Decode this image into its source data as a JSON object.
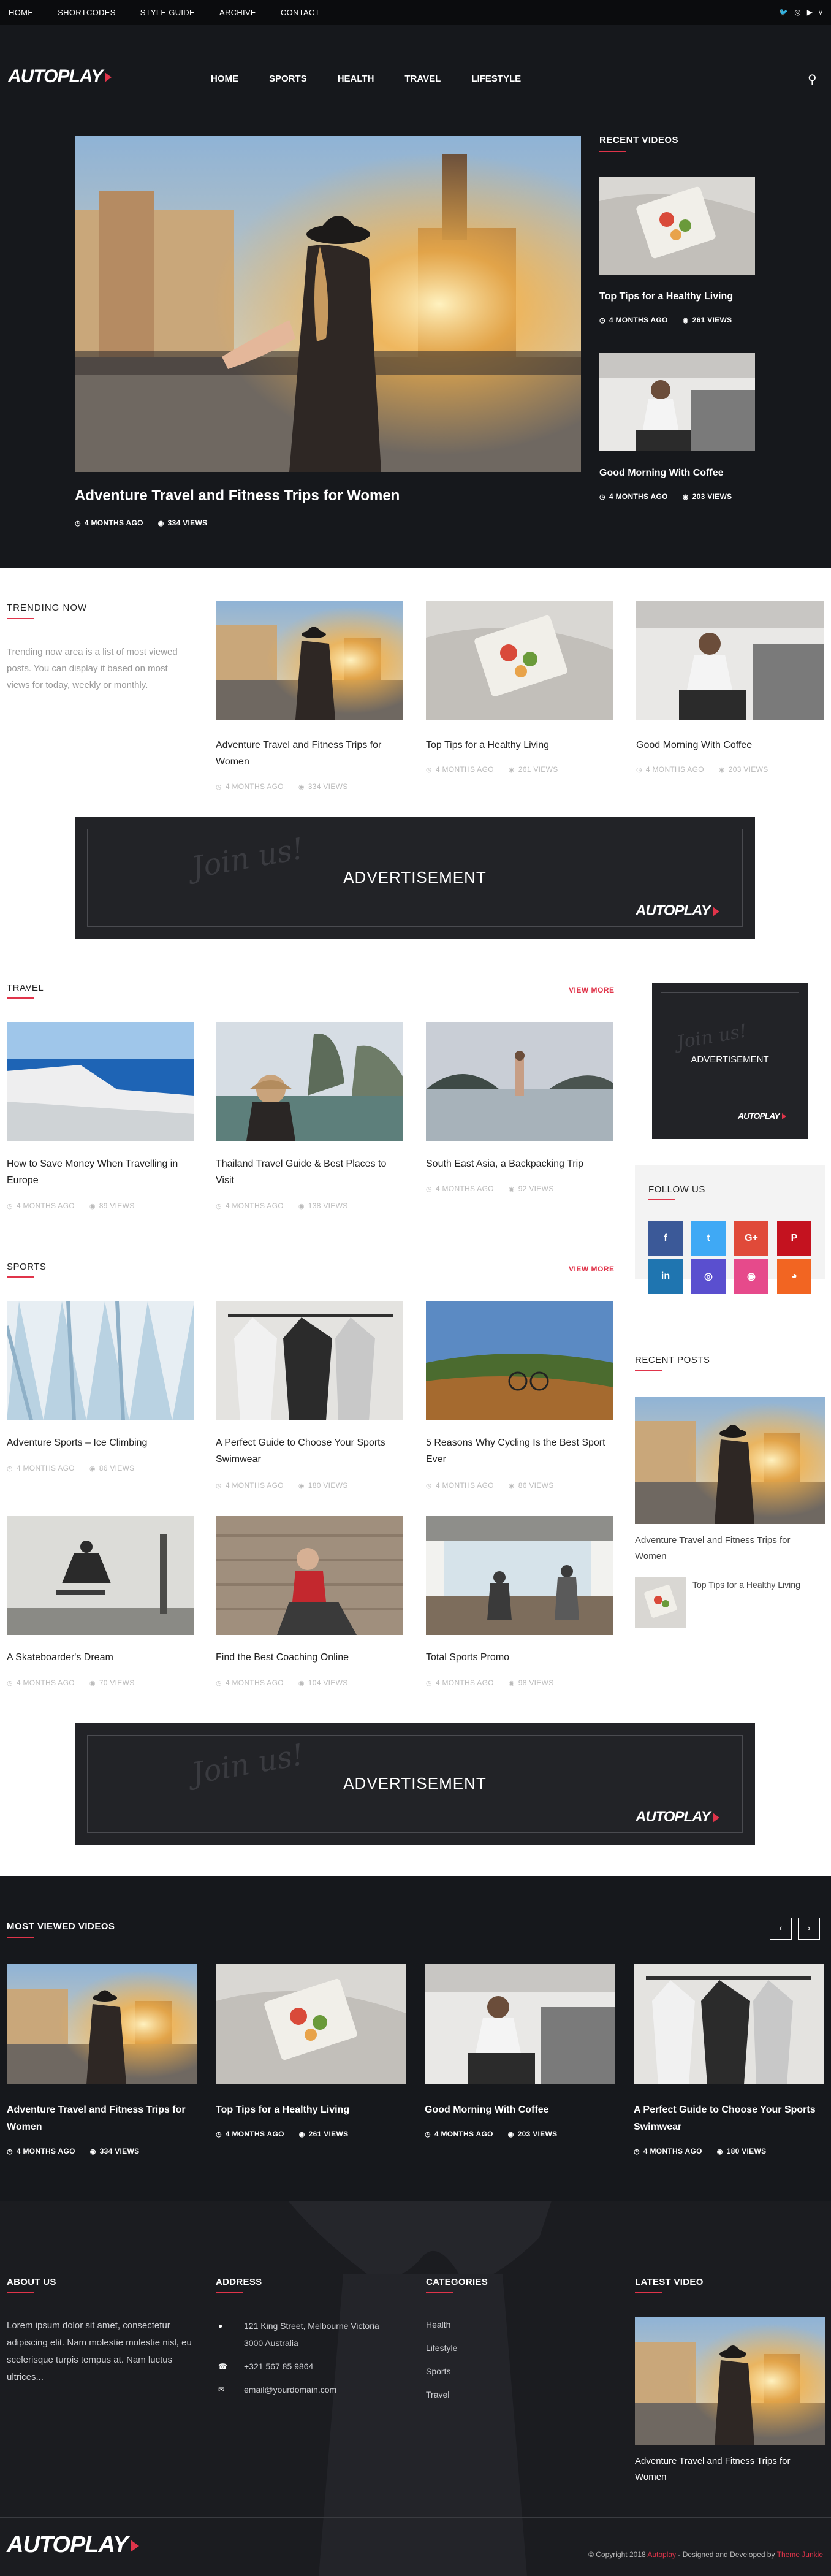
{
  "topbar": {
    "nav": [
      "HOME",
      "SHORTCODES",
      "STYLE GUIDE",
      "ARCHIVE",
      "CONTACT"
    ],
    "social": [
      "twitter-icon",
      "instagram-icon",
      "youtube-icon",
      "vimeo-icon"
    ]
  },
  "brand": {
    "name": "AUTOPLAY",
    "accent": "#e0344a"
  },
  "mainnav": [
    "HOME",
    "SPORTS",
    "HEALTH",
    "TRAVEL",
    "LIFESTYLE"
  ],
  "hero": {
    "title": "Adventure Travel and Fitness Trips for Women",
    "date": "4 MONTHS AGO",
    "views": "334 VIEWS"
  },
  "recent_videos": {
    "heading": "RECENT VIDEOS",
    "items": [
      {
        "title": "Top Tips for a Healthy Living",
        "date": "4 MONTHS AGO",
        "views": "261 VIEWS"
      },
      {
        "title": "Good Morning With Coffee",
        "date": "4 MONTHS AGO",
        "views": "203 VIEWS"
      }
    ]
  },
  "trending": {
    "heading": "TRENDING NOW",
    "desc": "Trending now area is a list of most viewed posts. You can display it based on most views for today, weekly or monthly.",
    "items": [
      {
        "title": "Adventure Travel and Fitness Trips for Women",
        "date": "4 MONTHS AGO",
        "views": "334 VIEWS"
      },
      {
        "title": "Top Tips for a Healthy Living",
        "date": "4 MONTHS AGO",
        "views": "261 VIEWS"
      },
      {
        "title": "Good Morning With Coffee",
        "date": "4 MONTHS AGO",
        "views": "203 VIEWS"
      }
    ]
  },
  "ad": {
    "label": "ADVERTISEMENT",
    "script": "Join us!"
  },
  "travel": {
    "heading": "TRAVEL",
    "view_more": "VIEW MORE",
    "items": [
      {
        "title": "How to Save Money When Travelling in Europe",
        "date": "4 MONTHS AGO",
        "views": "89 VIEWS"
      },
      {
        "title": "Thailand Travel Guide & Best Places to Visit",
        "date": "4 MONTHS AGO",
        "views": "138 VIEWS"
      },
      {
        "title": "South East Asia, a Backpacking Trip",
        "date": "4 MONTHS AGO",
        "views": "92 VIEWS"
      }
    ]
  },
  "sports": {
    "heading": "SPORTS",
    "view_more": "VIEW MORE",
    "items": [
      {
        "title": "Adventure Sports – Ice Climbing",
        "date": "4 MONTHS AGO",
        "views": "86 VIEWS"
      },
      {
        "title": "A Perfect Guide to Choose Your Sports Swimwear",
        "date": "4 MONTHS AGO",
        "views": "180 VIEWS"
      },
      {
        "title": "5 Reasons Why Cycling Is the Best Sport Ever",
        "date": "4 MONTHS AGO",
        "views": "86 VIEWS"
      },
      {
        "title": "A Skateboarder's Dream",
        "date": "4 MONTHS AGO",
        "views": "70 VIEWS"
      },
      {
        "title": "Find the Best Coaching Online",
        "date": "4 MONTHS AGO",
        "views": "104 VIEWS"
      },
      {
        "title": "Total Sports Promo",
        "date": "4 MONTHS AGO",
        "views": "98 VIEWS"
      }
    ]
  },
  "sidebar": {
    "follow_heading": "FOLLOW US",
    "social": [
      {
        "icon": "facebook-icon",
        "glyph": "f",
        "color": "#3b5998"
      },
      {
        "icon": "twitter-icon",
        "glyph": "t",
        "color": "#3fa9f5"
      },
      {
        "icon": "google-plus-icon",
        "glyph": "G+",
        "color": "#e04a39"
      },
      {
        "icon": "pinterest-icon",
        "glyph": "P",
        "color": "#c4121f"
      },
      {
        "icon": "linkedin-icon",
        "glyph": "in",
        "color": "#1f75b0"
      },
      {
        "icon": "instagram-icon",
        "glyph": "◎",
        "color": "#5a4fcf"
      },
      {
        "icon": "dribbble-icon",
        "glyph": "◉",
        "color": "#e64a8b"
      },
      {
        "icon": "rss-icon",
        "glyph": "◕",
        "color": "#f26522"
      }
    ],
    "recent_heading": "RECENT POSTS",
    "recent": [
      {
        "title": "Adventure Travel and Fitness Trips for Women"
      },
      {
        "title": "Top Tips for a Healthy Living"
      }
    ]
  },
  "most_viewed": {
    "heading": "MOST VIEWED VIDEOS",
    "prev": "‹",
    "next": "›",
    "items": [
      {
        "title": "Adventure Travel and Fitness Trips for Women",
        "date": "4 MONTHS AGO",
        "views": "334 VIEWS"
      },
      {
        "title": "Top Tips for a Healthy Living",
        "date": "4 MONTHS AGO",
        "views": "261 VIEWS"
      },
      {
        "title": "Good Morning With Coffee",
        "date": "4 MONTHS AGO",
        "views": "203 VIEWS"
      },
      {
        "title": "A Perfect Guide to Choose Your Sports Swimwear",
        "date": "4 MONTHS AGO",
        "views": "180 VIEWS"
      }
    ]
  },
  "footer": {
    "about": {
      "heading": "ABOUT US",
      "text": "Lorem ipsum dolor sit amet, consectetur adipiscing elit. Nam molestie molestie nisl, eu scelerisque turpis tempus at. Nam luctus ultrices..."
    },
    "address": {
      "heading": "ADDRESS",
      "street": "121 King Street, Melbourne Victoria",
      "city": "3000 Australia",
      "phone": "+321 567 85 9864",
      "email": "email@yourdomain.com"
    },
    "categories": {
      "heading": "CATEGORIES",
      "items": [
        "Health",
        "Lifestyle",
        "Sports",
        "Travel"
      ]
    },
    "latest": {
      "heading": "LATEST VIDEO",
      "title": "Adventure Travel and Fitness Trips for Women"
    },
    "copyright_pre": "© Copyright 2018",
    "copyright_brand": "Autoplay",
    "copyright_mid": "- Designed and Developed by",
    "copyright_dev": "Theme Junkie"
  }
}
